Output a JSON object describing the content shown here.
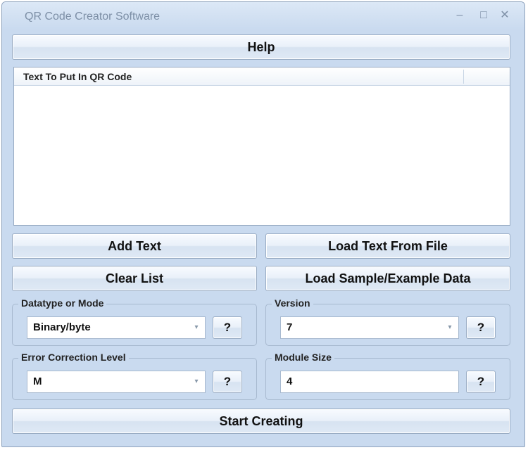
{
  "window": {
    "title": "QR Code Creator Software",
    "minimize": "–",
    "maximize": "□",
    "close": "✕"
  },
  "buttons": {
    "help": "Help",
    "add_text": "Add Text",
    "load_text_from_file": "Load Text From File",
    "clear_list": "Clear List",
    "load_sample": "Load Sample/Example Data",
    "start_creating": "Start Creating",
    "question": "?"
  },
  "list": {
    "column_header": "Text To Put In QR Code",
    "rows": []
  },
  "datatype": {
    "label": "Datatype or Mode",
    "selected": "Binary/byte"
  },
  "version": {
    "label": "Version",
    "selected": "7"
  },
  "error_correction": {
    "label": "Error Correction Level",
    "selected": "M"
  },
  "module_size": {
    "label": "Module Size",
    "value": "4"
  },
  "icons": {
    "dropdown_arrow": "▾"
  }
}
